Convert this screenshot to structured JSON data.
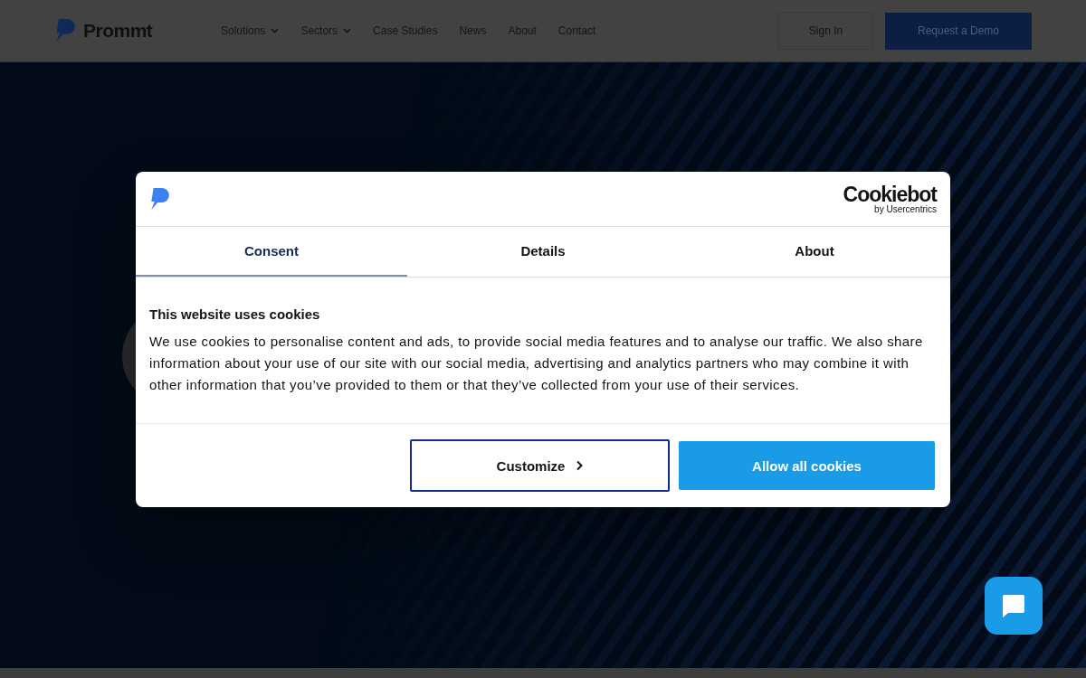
{
  "header": {
    "brand": "Prommt",
    "nav": [
      {
        "label": "Solutions",
        "dropdown": true
      },
      {
        "label": "Sectors",
        "dropdown": true
      },
      {
        "label": "Case Studies",
        "dropdown": false
      },
      {
        "label": "News",
        "dropdown": false
      },
      {
        "label": "About",
        "dropdown": false
      },
      {
        "label": "Contact",
        "dropdown": false
      }
    ],
    "sign_in": "Sign In",
    "cta": "Request a Demo"
  },
  "cookie_dialog": {
    "vendor": {
      "name": "Cookiebot",
      "sub": "by Usercentrics"
    },
    "tabs": [
      {
        "label": "Consent",
        "selected": true
      },
      {
        "label": "Details",
        "selected": false
      },
      {
        "label": "About",
        "selected": false
      }
    ],
    "title": "This website uses cookies",
    "body": "We use cookies to personalise content and ads, to provide social media features and to analyse our traffic. We also share information about your use of our site with our social media, advertising and analytics partners who may combine it with other information that you’ve provided to them or that they’ve collected from your use of their services.",
    "buttons": [
      {
        "label": "Customize",
        "kind": "outline"
      },
      {
        "label": "Allow all cookies",
        "kind": "primary"
      }
    ]
  }
}
